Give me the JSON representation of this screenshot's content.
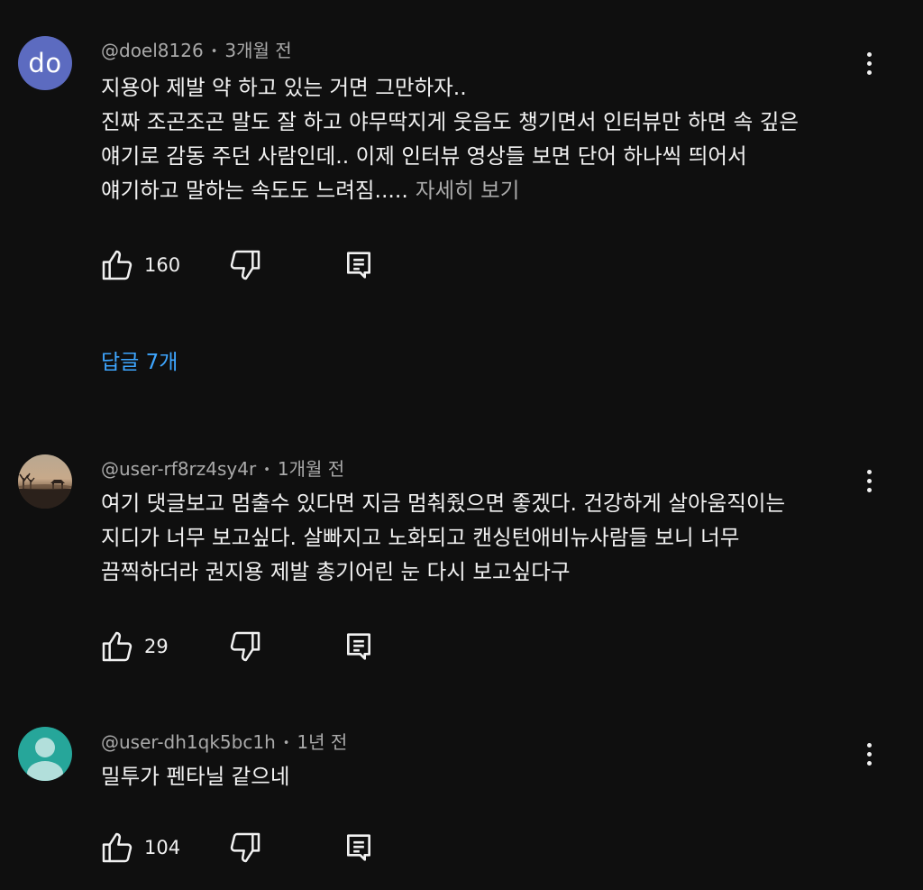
{
  "comments": [
    {
      "avatar_text": "do",
      "avatar_color": "#5c6bc0",
      "username": "@doel8126",
      "time": "3개월 전",
      "lines": [
        "지용아 제발 약 하고 있는 거면 그만하자..",
        "진짜 조곤조곤 말도 잘 하고 야무딱지게 웃음도 챙기면서 인터뷰만 하면 속 깊은",
        "얘기로 감동 주던 사람인데.. 이제 인터뷰 영상들 보면 단어 하나씩 띄어서",
        "얘기하고 말하는 속도도 느려짐....."
      ],
      "read_more": "자세히 보기",
      "likes": "160",
      "replies_label": "답글 7개"
    },
    {
      "avatar_icon": "sunset-photo-avatar",
      "username": "@user-rf8rz4sy4r",
      "time": "1개월 전",
      "lines": [
        "여기 댓글보고 멈출수 있다면 지금 멈춰줬으면 좋겠다. 건강하게 살아움직이는",
        "지디가 너무 보고싶다. 살빠지고 노화되고 캔싱턴애비뉴사람들 보니 너무",
        "끔찍하더라  권지용 제발 총기어린 눈 다시 보고싶다구"
      ],
      "likes": "29"
    },
    {
      "avatar_icon": "default-person-avatar",
      "avatar_color": "#26a69a",
      "username": "@user-dh1qk5bc1h",
      "time": "1년 전",
      "lines": [
        "밀투가 펜타닐 같으네"
      ],
      "likes": "104"
    }
  ],
  "icons": {
    "like": "thumbs-up-icon",
    "dislike": "thumbs-down-icon",
    "reply": "comment-icon",
    "menu": "more-vert-icon"
  },
  "colors": {
    "background": "#0f0f0f",
    "text": "#f1f1f1",
    "secondary_text": "#aaaaaa",
    "link": "#3ea6ff"
  }
}
